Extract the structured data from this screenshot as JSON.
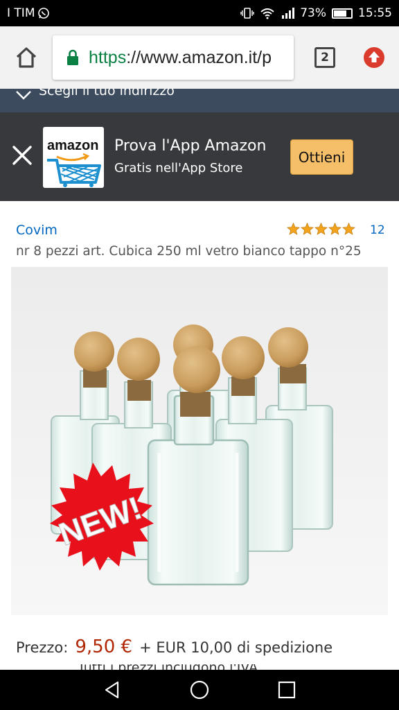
{
  "status_bar": {
    "carrier": "I TIM",
    "battery": "73%",
    "time": "15:55",
    "battery_level": 0.73
  },
  "browser": {
    "url_scheme": "https",
    "url_rest": "://www.amazon.it/p",
    "tab_count": "2",
    "accent_color": "#0b8043"
  },
  "address_strip": {
    "text": "Scegli il tuo indirizzo"
  },
  "app_banner": {
    "logo_text": "amazon",
    "title": "Prova l'App Amazon",
    "subtitle": "Gratis nell'App Store",
    "button_label": "Ottieni",
    "button_color": "#f5bf6a"
  },
  "product": {
    "brand": "Covim",
    "rating_stars": 5,
    "review_count": "12",
    "title": "nr 8 pezzi art. Cubica 250 ml vetro bianco tappo n°25",
    "badge_text": "NEW!"
  },
  "price": {
    "label": "Prezzo:",
    "value": "9,50 €",
    "shipping": "+ EUR 10,00 di spedizione",
    "next_line_partial": "Tutti i prezzi includono l'IVA",
    "price_color": "#b12704"
  }
}
